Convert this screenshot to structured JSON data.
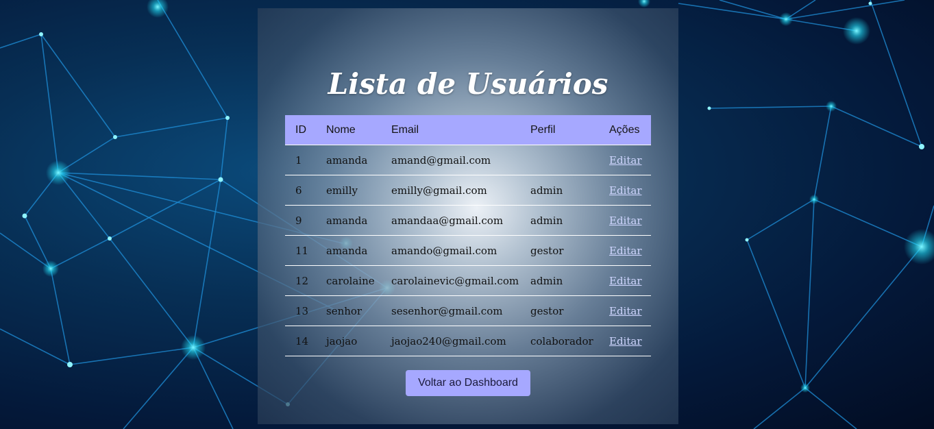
{
  "page": {
    "title": "Lista de Usuários"
  },
  "table": {
    "headers": {
      "id": "ID",
      "nome": "Nome",
      "email": "Email",
      "perfil": "Perfil",
      "acoes": "Ações"
    },
    "rows": [
      {
        "id": "1",
        "nome": "amanda",
        "email": "amand@gmail.com",
        "perfil": "",
        "acao": "Editar"
      },
      {
        "id": "6",
        "nome": "emilly",
        "email": "emilly@gmail.com",
        "perfil": "admin",
        "acao": "Editar"
      },
      {
        "id": "9",
        "nome": "amanda",
        "email": "amandaa@gmail.com",
        "perfil": "admin",
        "acao": "Editar"
      },
      {
        "id": "11",
        "nome": "amanda",
        "email": "amando@gmail.com",
        "perfil": "gestor",
        "acao": "Editar"
      },
      {
        "id": "12",
        "nome": "carolaine",
        "email": "carolainevic@gmail.com",
        "perfil": "admin",
        "acao": "Editar"
      },
      {
        "id": "13",
        "nome": "senhor",
        "email": "sesenhor@gmail.com",
        "perfil": "gestor",
        "acao": "Editar"
      },
      {
        "id": "14",
        "nome": "jaojao",
        "email": "jaojao240@gmail.com",
        "perfil": "colaborador",
        "acao": "Editar"
      }
    ]
  },
  "actions": {
    "back_label": "Voltar ao Dashboard"
  },
  "colors": {
    "accent": "#a6a8ff",
    "background": "#04193a",
    "link": "#cfd6ff"
  }
}
